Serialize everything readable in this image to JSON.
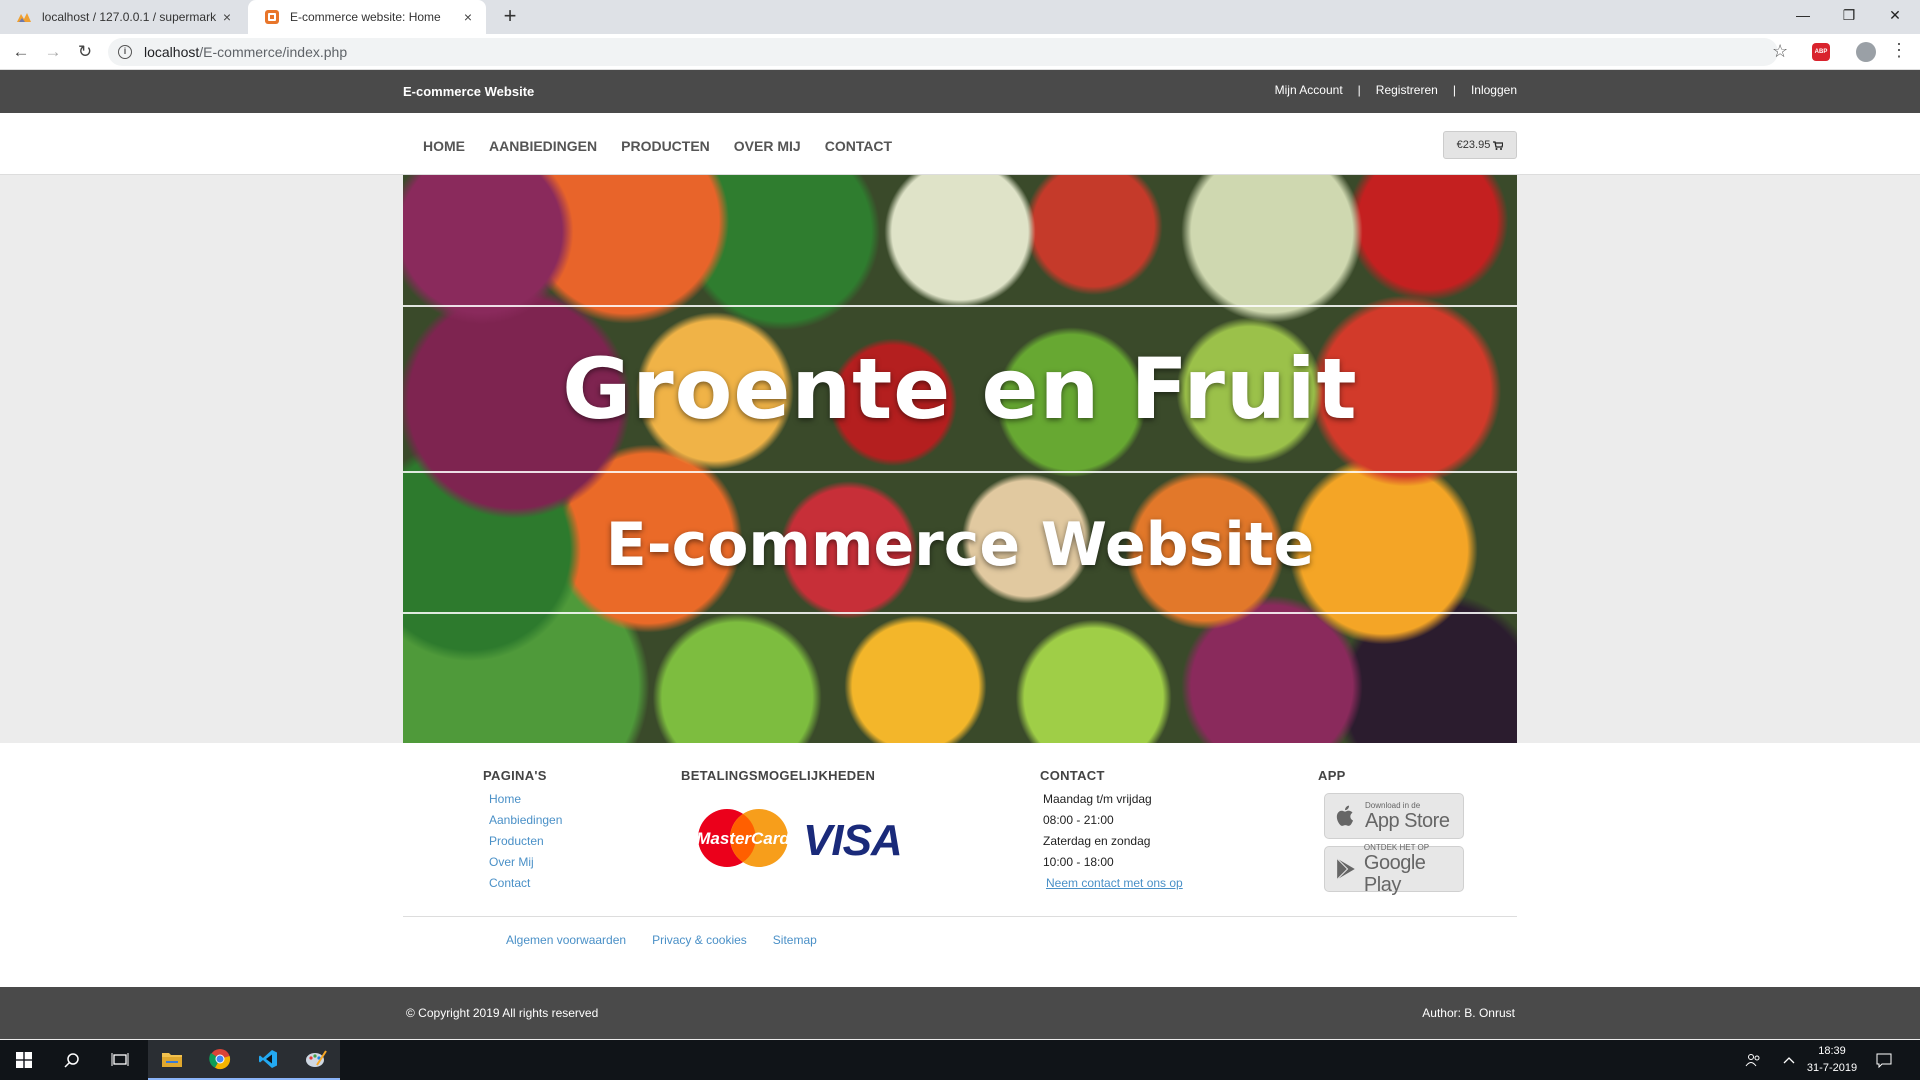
{
  "browser": {
    "tabs": [
      {
        "title": "localhost / 127.0.0.1 / supermark",
        "close": "×"
      },
      {
        "title": "E-commerce website: Home",
        "close": "×"
      }
    ],
    "new_tab": "+",
    "window_controls": {
      "minimize": "—",
      "maximize": "❐",
      "close": "✕"
    },
    "nav": {
      "back": "←",
      "forward": "→",
      "reload": "↻"
    },
    "url_host": "localhost",
    "url_path": "/E-commerce/index.php",
    "bookmark_star": "☆",
    "extension_label": "ABP",
    "menu": "⋮"
  },
  "site": {
    "brand": "E-commerce Website",
    "top_links": [
      "Mijn Account",
      "Registreren",
      "Inloggen"
    ],
    "top_sep": "|",
    "nav": [
      "HOME",
      "AANBIEDINGEN",
      "PRODUCTEN",
      "OVER MIJ",
      "CONTACT"
    ],
    "cart_total": "€23.95",
    "cart_icon": "🛒",
    "hero": {
      "title": "Groente en Fruit",
      "subtitle": "E-commerce Website"
    },
    "footer": {
      "pages": {
        "heading": "PAGINA'S",
        "links": [
          "Home",
          "Aanbiedingen",
          "Producten",
          "Over Mij",
          "Contact"
        ]
      },
      "payment": {
        "heading": "BETALINGSMOGELIJKHEDEN",
        "mastercard": "MasterCard",
        "visa": "VISA"
      },
      "contact": {
        "heading": "CONTACT",
        "lines": [
          "Maandag t/m vrijdag",
          "08:00 - 21:00",
          "Zaterdag en zondag",
          "10:00 - 18:00"
        ],
        "link": "Neem contact met ons op"
      },
      "app": {
        "heading": "APP",
        "appstore_small": "Download in de",
        "appstore_big": "App Store",
        "play_small": "ONTDEK HET OP",
        "play_big": "Google Play"
      },
      "bottom_links": [
        "Algemen voorwaarden",
        "Privacy & cookies",
        "Sitemap"
      ]
    },
    "copyright": "© Copyright 2019 All rights reserved",
    "author": "Author: B. Onrust"
  },
  "taskbar": {
    "time": "18:39",
    "date": "31-7-2019"
  },
  "colors": {
    "dark_bar": "#4a4a4a",
    "link_blue": "#4a90c7",
    "taskbar": "#101418"
  }
}
